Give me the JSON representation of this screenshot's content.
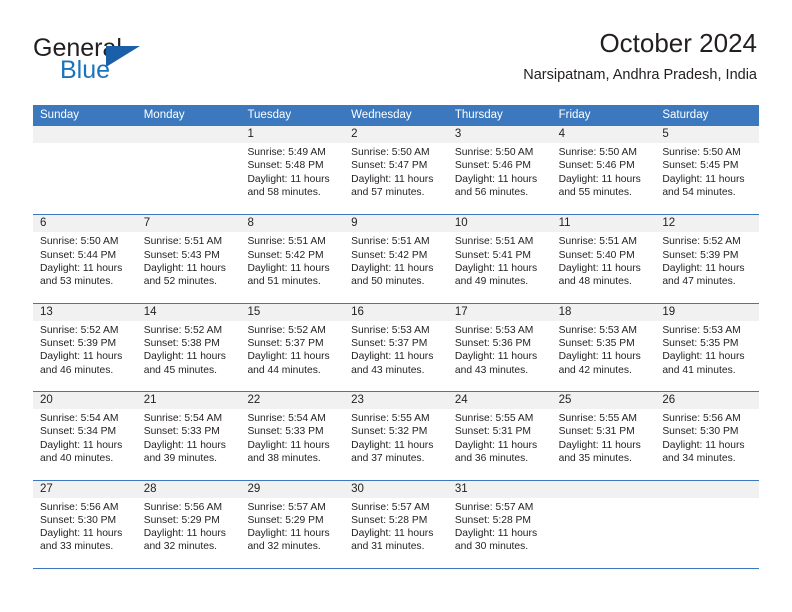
{
  "logo": {
    "word_top": "General",
    "word_bottom": "Blue"
  },
  "header": {
    "title": "October 2024",
    "subtitle": "Narsipatnam, Andhra Pradesh, India"
  },
  "colors": {
    "header_blue": "#3b78be",
    "logo_blue": "#1b74bb",
    "day_strip_gray": "#f1f1f1",
    "text": "#231f20"
  },
  "weekdays": [
    "Sunday",
    "Monday",
    "Tuesday",
    "Wednesday",
    "Thursday",
    "Friday",
    "Saturday"
  ],
  "labels": {
    "sunrise_prefix": "Sunrise: ",
    "sunset_prefix": "Sunset: ",
    "daylight_prefix": "Daylight: "
  },
  "weeks": [
    [
      {
        "day": ""
      },
      {
        "day": ""
      },
      {
        "day": "1",
        "sunrise": "Sunrise: 5:49 AM",
        "sunset": "Sunset: 5:48 PM",
        "daylight": "Daylight: 11 hours and 58 minutes."
      },
      {
        "day": "2",
        "sunrise": "Sunrise: 5:50 AM",
        "sunset": "Sunset: 5:47 PM",
        "daylight": "Daylight: 11 hours and 57 minutes."
      },
      {
        "day": "3",
        "sunrise": "Sunrise: 5:50 AM",
        "sunset": "Sunset: 5:46 PM",
        "daylight": "Daylight: 11 hours and 56 minutes."
      },
      {
        "day": "4",
        "sunrise": "Sunrise: 5:50 AM",
        "sunset": "Sunset: 5:46 PM",
        "daylight": "Daylight: 11 hours and 55 minutes."
      },
      {
        "day": "5",
        "sunrise": "Sunrise: 5:50 AM",
        "sunset": "Sunset: 5:45 PM",
        "daylight": "Daylight: 11 hours and 54 minutes."
      }
    ],
    [
      {
        "day": "6",
        "sunrise": "Sunrise: 5:50 AM",
        "sunset": "Sunset: 5:44 PM",
        "daylight": "Daylight: 11 hours and 53 minutes."
      },
      {
        "day": "7",
        "sunrise": "Sunrise: 5:51 AM",
        "sunset": "Sunset: 5:43 PM",
        "daylight": "Daylight: 11 hours and 52 minutes."
      },
      {
        "day": "8",
        "sunrise": "Sunrise: 5:51 AM",
        "sunset": "Sunset: 5:42 PM",
        "daylight": "Daylight: 11 hours and 51 minutes."
      },
      {
        "day": "9",
        "sunrise": "Sunrise: 5:51 AM",
        "sunset": "Sunset: 5:42 PM",
        "daylight": "Daylight: 11 hours and 50 minutes."
      },
      {
        "day": "10",
        "sunrise": "Sunrise: 5:51 AM",
        "sunset": "Sunset: 5:41 PM",
        "daylight": "Daylight: 11 hours and 49 minutes."
      },
      {
        "day": "11",
        "sunrise": "Sunrise: 5:51 AM",
        "sunset": "Sunset: 5:40 PM",
        "daylight": "Daylight: 11 hours and 48 minutes."
      },
      {
        "day": "12",
        "sunrise": "Sunrise: 5:52 AM",
        "sunset": "Sunset: 5:39 PM",
        "daylight": "Daylight: 11 hours and 47 minutes."
      }
    ],
    [
      {
        "day": "13",
        "sunrise": "Sunrise: 5:52 AM",
        "sunset": "Sunset: 5:39 PM",
        "daylight": "Daylight: 11 hours and 46 minutes."
      },
      {
        "day": "14",
        "sunrise": "Sunrise: 5:52 AM",
        "sunset": "Sunset: 5:38 PM",
        "daylight": "Daylight: 11 hours and 45 minutes."
      },
      {
        "day": "15",
        "sunrise": "Sunrise: 5:52 AM",
        "sunset": "Sunset: 5:37 PM",
        "daylight": "Daylight: 11 hours and 44 minutes."
      },
      {
        "day": "16",
        "sunrise": "Sunrise: 5:53 AM",
        "sunset": "Sunset: 5:37 PM",
        "daylight": "Daylight: 11 hours and 43 minutes."
      },
      {
        "day": "17",
        "sunrise": "Sunrise: 5:53 AM",
        "sunset": "Sunset: 5:36 PM",
        "daylight": "Daylight: 11 hours and 43 minutes."
      },
      {
        "day": "18",
        "sunrise": "Sunrise: 5:53 AM",
        "sunset": "Sunset: 5:35 PM",
        "daylight": "Daylight: 11 hours and 42 minutes."
      },
      {
        "day": "19",
        "sunrise": "Sunrise: 5:53 AM",
        "sunset": "Sunset: 5:35 PM",
        "daylight": "Daylight: 11 hours and 41 minutes."
      }
    ],
    [
      {
        "day": "20",
        "sunrise": "Sunrise: 5:54 AM",
        "sunset": "Sunset: 5:34 PM",
        "daylight": "Daylight: 11 hours and 40 minutes."
      },
      {
        "day": "21",
        "sunrise": "Sunrise: 5:54 AM",
        "sunset": "Sunset: 5:33 PM",
        "daylight": "Daylight: 11 hours and 39 minutes."
      },
      {
        "day": "22",
        "sunrise": "Sunrise: 5:54 AM",
        "sunset": "Sunset: 5:33 PM",
        "daylight": "Daylight: 11 hours and 38 minutes."
      },
      {
        "day": "23",
        "sunrise": "Sunrise: 5:55 AM",
        "sunset": "Sunset: 5:32 PM",
        "daylight": "Daylight: 11 hours and 37 minutes."
      },
      {
        "day": "24",
        "sunrise": "Sunrise: 5:55 AM",
        "sunset": "Sunset: 5:31 PM",
        "daylight": "Daylight: 11 hours and 36 minutes."
      },
      {
        "day": "25",
        "sunrise": "Sunrise: 5:55 AM",
        "sunset": "Sunset: 5:31 PM",
        "daylight": "Daylight: 11 hours and 35 minutes."
      },
      {
        "day": "26",
        "sunrise": "Sunrise: 5:56 AM",
        "sunset": "Sunset: 5:30 PM",
        "daylight": "Daylight: 11 hours and 34 minutes."
      }
    ],
    [
      {
        "day": "27",
        "sunrise": "Sunrise: 5:56 AM",
        "sunset": "Sunset: 5:30 PM",
        "daylight": "Daylight: 11 hours and 33 minutes."
      },
      {
        "day": "28",
        "sunrise": "Sunrise: 5:56 AM",
        "sunset": "Sunset: 5:29 PM",
        "daylight": "Daylight: 11 hours and 32 minutes."
      },
      {
        "day": "29",
        "sunrise": "Sunrise: 5:57 AM",
        "sunset": "Sunset: 5:29 PM",
        "daylight": "Daylight: 11 hours and 32 minutes."
      },
      {
        "day": "30",
        "sunrise": "Sunrise: 5:57 AM",
        "sunset": "Sunset: 5:28 PM",
        "daylight": "Daylight: 11 hours and 31 minutes."
      },
      {
        "day": "31",
        "sunrise": "Sunrise: 5:57 AM",
        "sunset": "Sunset: 5:28 PM",
        "daylight": "Daylight: 11 hours and 30 minutes."
      },
      {
        "day": ""
      },
      {
        "day": ""
      }
    ]
  ]
}
